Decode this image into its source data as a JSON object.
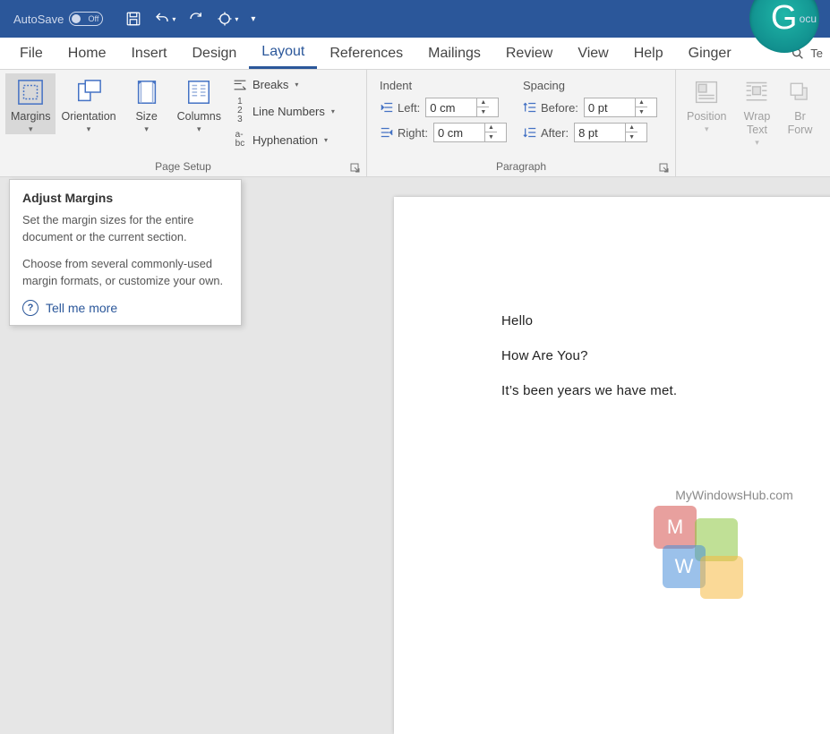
{
  "titlebar": {
    "autosave_label": "AutoSave",
    "autosave_state": "Off",
    "doc_fragment": "ocu",
    "grammarly_letter": "G"
  },
  "tabs": {
    "file": "File",
    "home": "Home",
    "insert": "Insert",
    "design": "Design",
    "layout": "Layout",
    "references": "References",
    "mailings": "Mailings",
    "review": "Review",
    "view": "View",
    "help": "Help",
    "ginger": "Ginger",
    "tell_me": "Te"
  },
  "ribbon": {
    "page_setup": {
      "group_label": "Page Setup",
      "margins": "Margins",
      "orientation": "Orientation",
      "size": "Size",
      "columns": "Columns",
      "breaks": "Breaks",
      "line_numbers": "Line Numbers",
      "hyphenation": "Hyphenation"
    },
    "paragraph": {
      "group_label": "Paragraph",
      "indent_label": "Indent",
      "spacing_label": "Spacing",
      "left_label": "Left:",
      "right_label": "Right:",
      "before_label": "Before:",
      "after_label": "After:",
      "left_value": "0 cm",
      "right_value": "0 cm",
      "before_value": "0 pt",
      "after_value": "8 pt"
    },
    "arrange": {
      "position": "Position",
      "wrap_text_1": "Wrap",
      "wrap_text_2": "Text",
      "bring_forward_1": "Br",
      "bring_forward_2": "Forw"
    }
  },
  "tooltip": {
    "title": "Adjust Margins",
    "p1": "Set the margin sizes for the entire document or the current section.",
    "p2": "Choose from several commonly-used margin formats, or customize your own.",
    "tell_more": "Tell me more"
  },
  "document": {
    "line1": "Hello",
    "line2": "How Are You?",
    "line3": "It’s been years we have met."
  },
  "watermark": "MyWindowsHub.com"
}
